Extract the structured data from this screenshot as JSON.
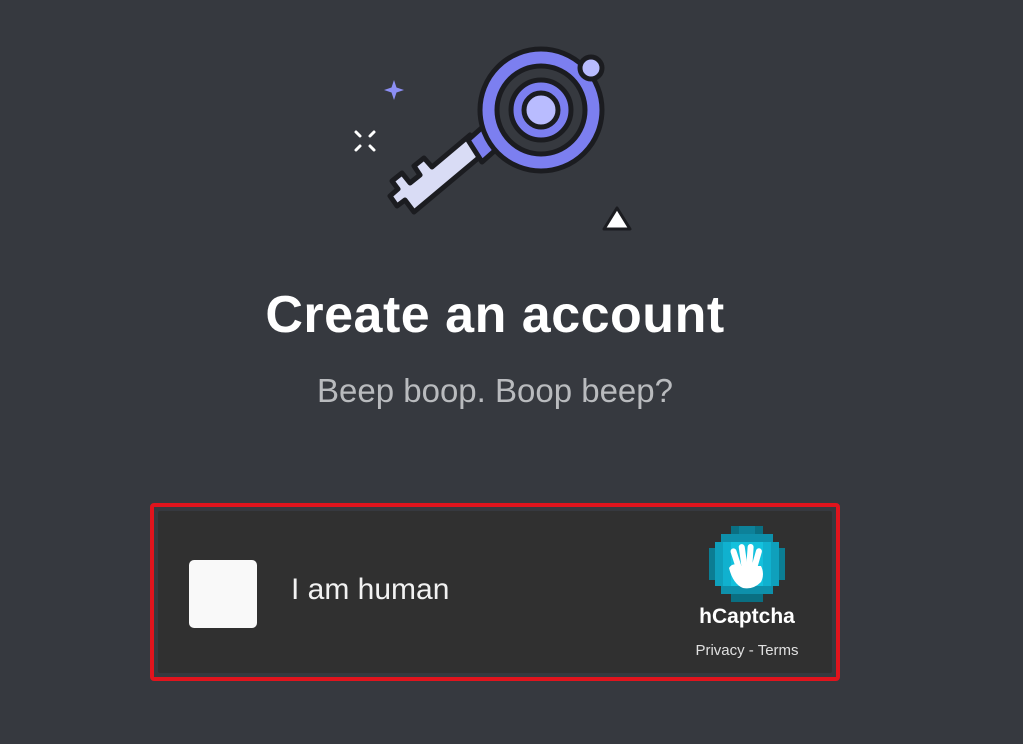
{
  "heading": {
    "title": "Create an account",
    "subtitle": "Beep boop. Boop beep?"
  },
  "captcha": {
    "checkbox_label": "I am human",
    "brand": "hCaptcha",
    "privacy_label": "Privacy",
    "separator": " - ",
    "terms_label": "Terms",
    "border_color": "#e0141d",
    "background_color": "#303030"
  },
  "colors": {
    "page_background": "#36393f",
    "accent_blurple": "#7c7ff0",
    "key_lavender": "#d9dcf5"
  },
  "illustration": {
    "icon": "key-icon"
  }
}
